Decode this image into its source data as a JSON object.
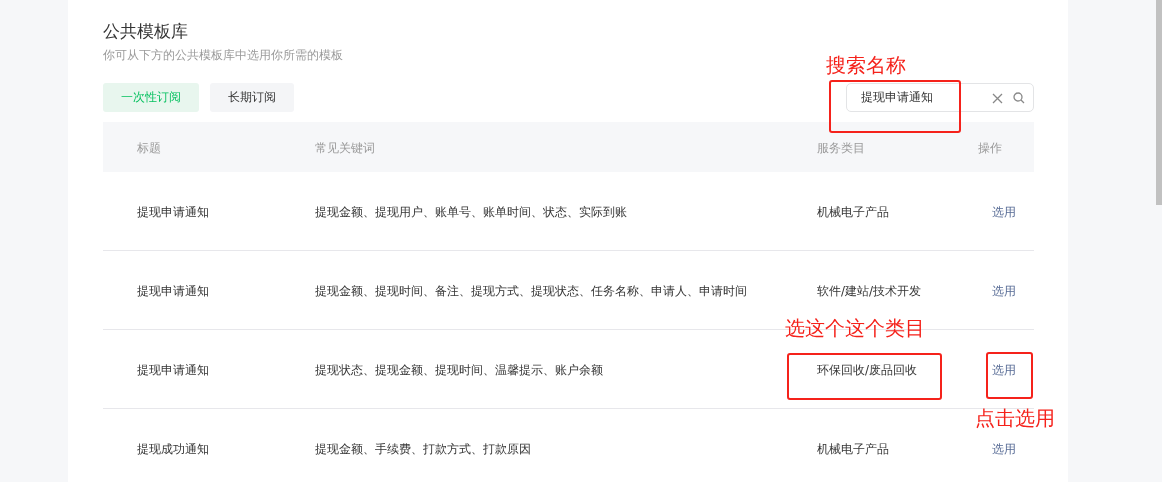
{
  "title": "公共模板库",
  "subtitle": "你可从下方的公共模板库中选用你所需的模板",
  "tabs": [
    {
      "label": "一次性订阅",
      "selected": true
    },
    {
      "label": "长期订阅",
      "selected": false
    }
  ],
  "search": {
    "value": "提现申请通知"
  },
  "table": {
    "columns": [
      "标题",
      "常见关键词",
      "服务类目",
      "操作"
    ],
    "rows": [
      {
        "title": "提现申请通知",
        "keywords": "提现金额、提现用户、账单号、账单时间、状态、实际到账",
        "category": "机械电子产品",
        "action": "选用"
      },
      {
        "title": "提现申请通知",
        "keywords": "提现金额、提现时间、备注、提现方式、提现状态、任务名称、申请人、申请时间",
        "category": "软件/建站/技术开发",
        "action": "选用"
      },
      {
        "title": "提现申请通知",
        "keywords": "提现状态、提现金额、提现时间、温馨提示、账户余额",
        "category": "环保回收/废品回收",
        "action": "选用"
      },
      {
        "title": "提现成功通知",
        "keywords": "提现金额、手续费、打款方式、打款原因",
        "category": "机械电子产品",
        "action": "选用"
      }
    ]
  },
  "annotations": [
    {
      "label": "搜索名称"
    },
    {
      "label": "选这个这个类目"
    },
    {
      "label": "点击选用"
    }
  ]
}
